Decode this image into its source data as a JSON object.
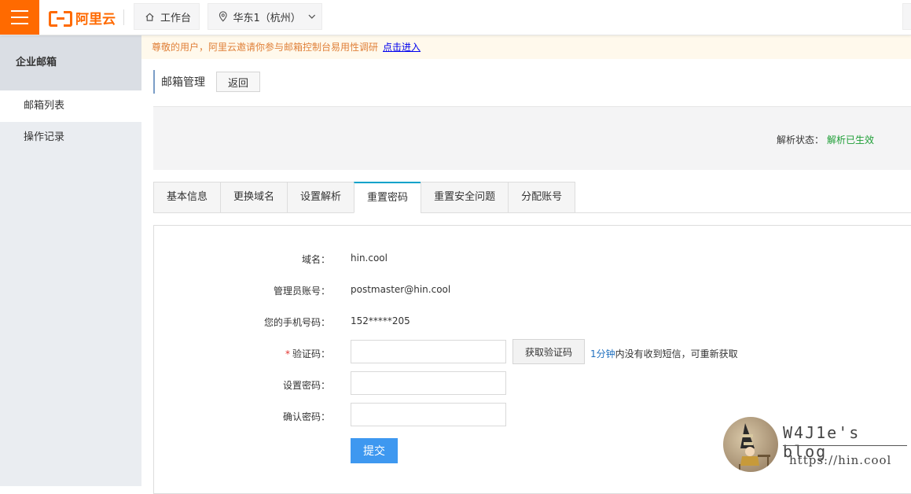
{
  "topbar": {
    "logo_text": "阿里云",
    "workbench_label": "工作台",
    "region_label": "华东1（杭州）"
  },
  "sidebar": {
    "title": "企业邮箱",
    "items": [
      {
        "label": "邮箱列表",
        "active": true
      },
      {
        "label": "操作记录",
        "active": false
      }
    ]
  },
  "notice": {
    "message": "尊敬的用户，阿里云邀请你参与邮箱控制台易用性调研",
    "link_text": "点击进入"
  },
  "page": {
    "title": "邮箱管理",
    "back_label": "返回",
    "status_label": "解析状态：",
    "status_value": "解析已生效"
  },
  "tabs": [
    {
      "label": "基本信息",
      "active": false
    },
    {
      "label": "更换域名",
      "active": false
    },
    {
      "label": "设置解析",
      "active": false
    },
    {
      "label": "重置密码",
      "active": true
    },
    {
      "label": "重置安全问题",
      "active": false
    },
    {
      "label": "分配账号",
      "active": false
    }
  ],
  "form": {
    "domain_label": "域名：",
    "domain_value": "hin.cool",
    "admin_label": "管理员账号：",
    "admin_value": "postmaster@hin.cool",
    "phone_label": "您的手机号码：",
    "phone_value": "152*****205",
    "code_required_mark": "*",
    "code_label": "验证码：",
    "code_value": "",
    "get_code_label": "获取验证码",
    "code_hint_highlight": "1分钟",
    "code_hint_rest": "内没有收到短信，可重新获取",
    "password_label": "设置密码：",
    "password_value": "",
    "confirm_label": "确认密码：",
    "confirm_value": "",
    "submit_label": "提交"
  },
  "watermark": {
    "title": "W4J1e's blog",
    "url": "https://hin.cool"
  },
  "colors": {
    "brand": "#ff6a00",
    "status_ok": "#1e9e36",
    "primary_button": "#3e98f0",
    "active_tab_accent": "#00a2ca"
  }
}
